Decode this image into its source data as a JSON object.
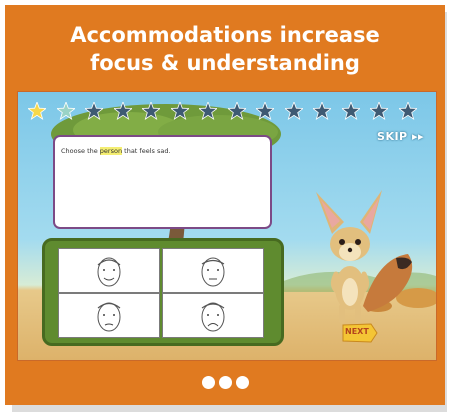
{
  "header": {
    "line1": "Accommodations increase",
    "line2": "focus & understanding"
  },
  "progress": {
    "total_stars": 14,
    "completed_stars": 1,
    "current_star": 2
  },
  "skip_label": "SKIP ▸▸",
  "question": {
    "prefix": "Choose the ",
    "highlight": "person",
    "suffix": " that feels sad."
  },
  "answers": [
    {
      "name": "face-option-1"
    },
    {
      "name": "face-option-2"
    },
    {
      "name": "face-option-3"
    },
    {
      "name": "face-option-4"
    }
  ],
  "next_label": "NEXT",
  "carousel": {
    "dots": 3
  },
  "colors": {
    "brand_orange": "#e07a20",
    "answer_panel_green": "#5f8b2f",
    "question_border_purple": "#7c4a86",
    "star_completed": "#f7d84a",
    "star_current": "#9ad3c6",
    "star_pending": "#3e5a73"
  }
}
